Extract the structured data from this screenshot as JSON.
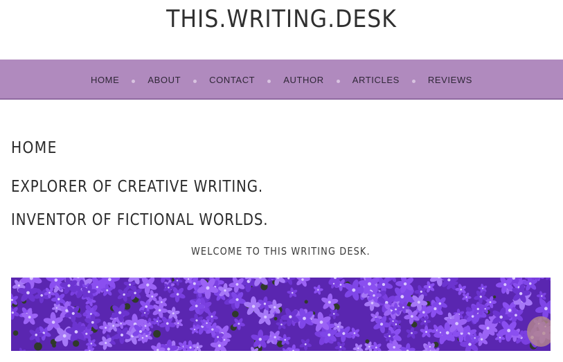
{
  "site": {
    "title": "THIS.WRITING.DESK"
  },
  "nav": {
    "items": [
      {
        "label": "HOME"
      },
      {
        "label": "ABOUT"
      },
      {
        "label": "CONTACT"
      },
      {
        "label": "AUTHOR"
      },
      {
        "label": "ARTICLES"
      },
      {
        "label": "REVIEWS"
      }
    ]
  },
  "main": {
    "heading": "HOME",
    "tagline_1": "EXPLORER OF CREATIVE WRITING.",
    "tagline_2": "INVENTOR OF FICTIONAL WORLDS.",
    "welcome": "WELCOME TO THIS WRITING DESK.",
    "hero_image": {
      "icon": "purple-flowers-photo"
    }
  },
  "colors": {
    "nav_background": "#b08abe",
    "text": "#2b2b2b",
    "flower_purple": "#7a3fe0"
  }
}
